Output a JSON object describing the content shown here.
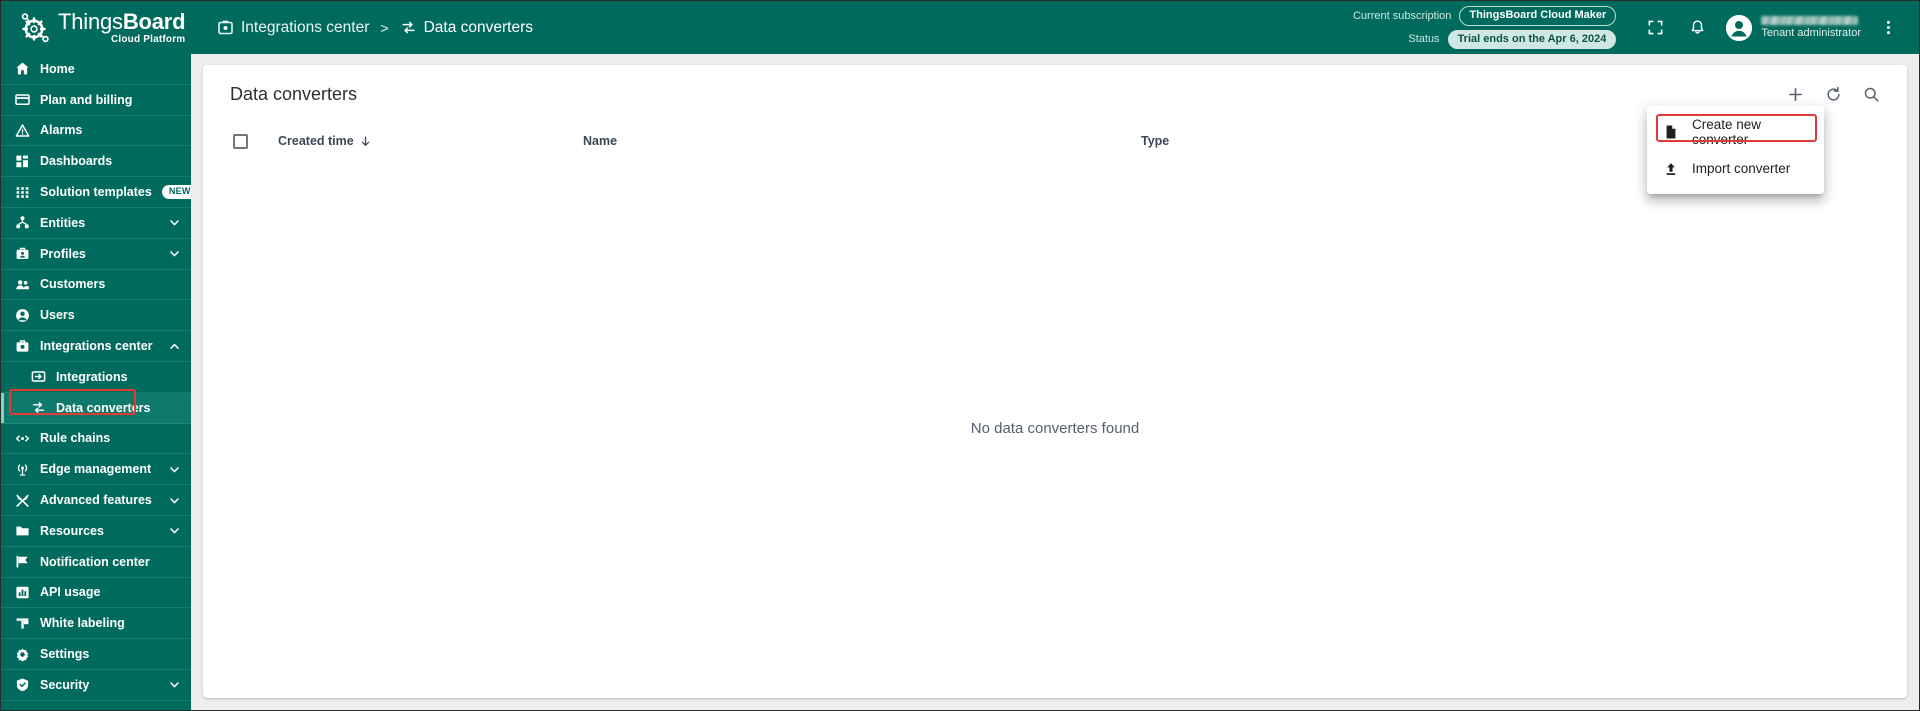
{
  "brand": {
    "name_light": "Things",
    "name_bold": "Board",
    "subtitle": "Cloud Platform",
    "logo_icon": "thingsboard-gear-logo"
  },
  "breadcrumb": {
    "parent": "Integrations center",
    "separator": ">",
    "current": "Data converters",
    "parent_icon": "integrations-center-icon",
    "current_icon": "data-converters-icon"
  },
  "subscription": {
    "label": "Current subscription",
    "plan": "ThingsBoard Cloud Maker",
    "status_label": "Status",
    "status_value": "Trial ends on the Apr 6, 2024"
  },
  "user": {
    "role": "Tenant administrator",
    "name_redacted": true
  },
  "top_actions": {
    "fullscreen_icon": "fullscreen-icon",
    "notifications_icon": "bell-icon",
    "avatar_icon": "account-circle-icon",
    "more_icon": "kebab-menu-icon"
  },
  "sidebar": {
    "items": [
      {
        "label": "Home",
        "icon": "home-icon",
        "level": 0,
        "expandable": false,
        "active": false
      },
      {
        "label": "Plan and billing",
        "icon": "credit-card-icon",
        "level": 0,
        "expandable": false,
        "active": false
      },
      {
        "label": "Alarms",
        "icon": "alarm-triangle-icon",
        "level": 0,
        "expandable": false,
        "active": false
      },
      {
        "label": "Dashboards",
        "icon": "dashboards-grid-icon",
        "level": 0,
        "expandable": false,
        "active": false
      },
      {
        "label": "Solution templates",
        "icon": "solution-templates-icon",
        "level": 0,
        "expandable": false,
        "active": false,
        "badge": "NEW"
      },
      {
        "label": "Entities",
        "icon": "entities-hierarchy-icon",
        "level": 0,
        "expandable": true,
        "active": false
      },
      {
        "label": "Profiles",
        "icon": "profiles-icon",
        "level": 0,
        "expandable": true,
        "active": false
      },
      {
        "label": "Customers",
        "icon": "customers-people-icon",
        "level": 0,
        "expandable": false,
        "active": false
      },
      {
        "label": "Users",
        "icon": "user-icon",
        "level": 0,
        "expandable": false,
        "active": false
      },
      {
        "label": "Integrations center",
        "icon": "integrations-center-icon",
        "level": 0,
        "expandable": true,
        "expanded": true,
        "active": false
      },
      {
        "label": "Integrations",
        "icon": "integrations-arrow-icon",
        "level": 1,
        "expandable": false,
        "active": false
      },
      {
        "label": "Data converters",
        "icon": "data-converters-icon",
        "level": 1,
        "expandable": false,
        "active": true,
        "annotated": true
      },
      {
        "label": "Rule chains",
        "icon": "rule-chains-icon",
        "level": 0,
        "expandable": false,
        "active": false
      },
      {
        "label": "Edge management",
        "icon": "edge-management-icon",
        "level": 0,
        "expandable": true,
        "active": false
      },
      {
        "label": "Advanced features",
        "icon": "advanced-features-icon",
        "level": 0,
        "expandable": true,
        "active": false
      },
      {
        "label": "Resources",
        "icon": "folder-icon",
        "level": 0,
        "expandable": true,
        "active": false
      },
      {
        "label": "Notification center",
        "icon": "notification-flag-icon",
        "level": 0,
        "expandable": false,
        "active": false
      },
      {
        "label": "API usage",
        "icon": "api-usage-chart-icon",
        "level": 0,
        "expandable": false,
        "active": false
      },
      {
        "label": "White labeling",
        "icon": "white-labeling-icon",
        "level": 0,
        "expandable": false,
        "active": false
      },
      {
        "label": "Settings",
        "icon": "gear-icon",
        "level": 0,
        "expandable": false,
        "active": false
      },
      {
        "label": "Security",
        "icon": "shield-icon",
        "level": 0,
        "expandable": true,
        "active": false
      }
    ]
  },
  "page": {
    "title": "Data converters",
    "actions": {
      "add_icon": "plus-icon",
      "refresh_icon": "refresh-icon",
      "search_icon": "search-icon"
    },
    "table": {
      "columns": [
        {
          "label": "",
          "key": "select"
        },
        {
          "label": "Created time",
          "key": "created_time",
          "sorted": "desc",
          "sort_icon": "arrow-down-icon"
        },
        {
          "label": "Name",
          "key": "name"
        },
        {
          "label": "Type",
          "key": "type"
        }
      ],
      "rows": [],
      "empty_message": "No data converters found"
    }
  },
  "menu": {
    "items": [
      {
        "label": "Create new converter",
        "icon": "document-icon",
        "annotated": true
      },
      {
        "label": "Import converter",
        "icon": "upload-icon",
        "annotated": false
      }
    ]
  },
  "colors": {
    "brand_teal": "#006b5d",
    "active_teal": "#0f7a6b",
    "annotation_red": "#e53935",
    "page_bg": "#eeeeee"
  }
}
